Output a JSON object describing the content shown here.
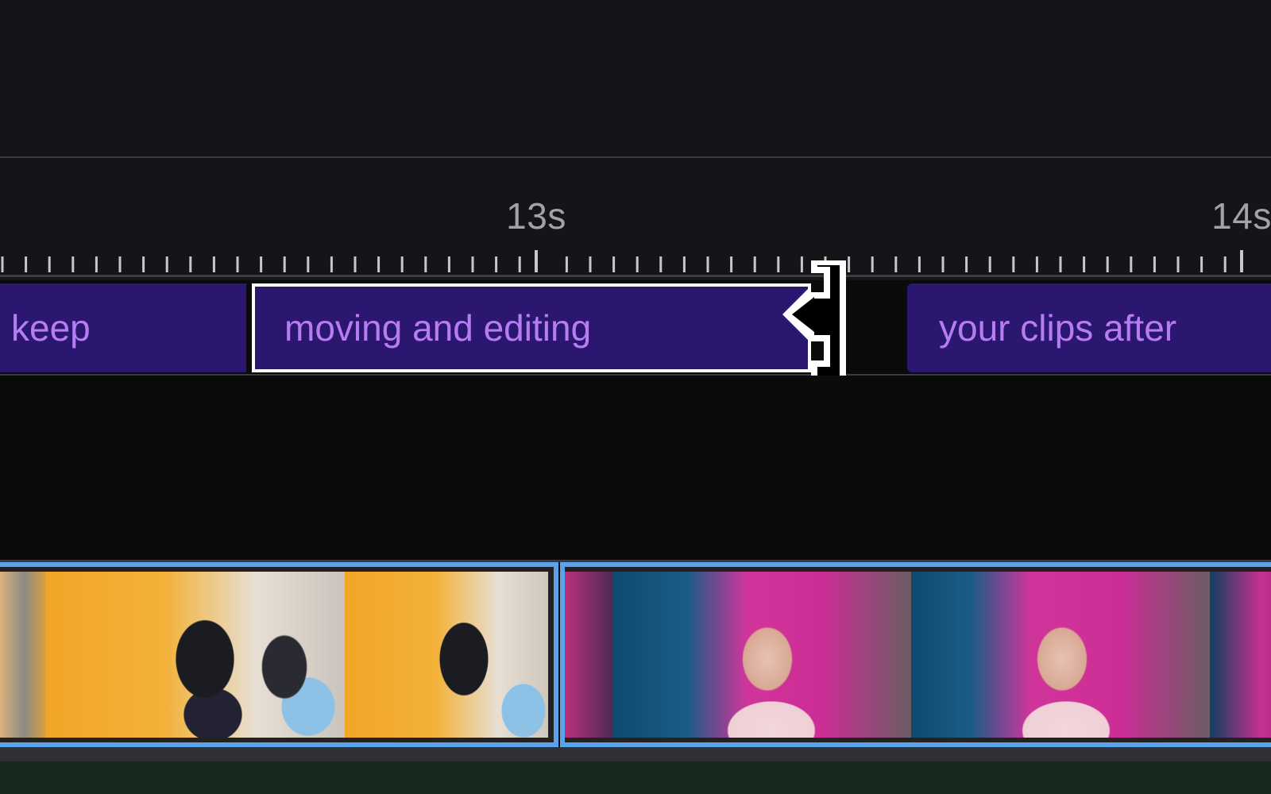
{
  "ruler": {
    "labels": [
      "13s",
      "14s"
    ]
  },
  "caption_track": {
    "clips": [
      {
        "text": "keep"
      },
      {
        "text": "moving and editing",
        "selected": true
      },
      {
        "text": "your clips after"
      }
    ]
  },
  "cursor": {
    "icon": "trim-end-cursor-icon"
  },
  "video_track": {
    "clips": [
      {
        "thumbnail": "group-friends-yellow-wall"
      },
      {
        "thumbnail": "girl-with-headphones-pink-studio"
      }
    ]
  },
  "colors": {
    "background": "#141518",
    "caption_clip": "#2c1770",
    "caption_text": "#b67df2",
    "video_border": "#5aa2ea",
    "audio_track": "#18291d"
  }
}
